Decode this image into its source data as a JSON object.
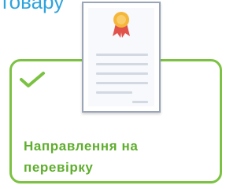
{
  "header": {
    "partial_text": "товару"
  },
  "card": {
    "label_line_1": "Направлення на",
    "label_line_2": "перевірку"
  },
  "icons": {
    "check": "check-icon",
    "document": "document-icon",
    "award": "award-ribbon-icon"
  },
  "colors": {
    "accent_green": "#7cc242",
    "text_green": "#5fae2e",
    "header_blue": "#2fa4dc",
    "document_border": "#9aa6b7",
    "seal_gold": "#f5b63a",
    "ribbon_red": "#e0524a"
  }
}
